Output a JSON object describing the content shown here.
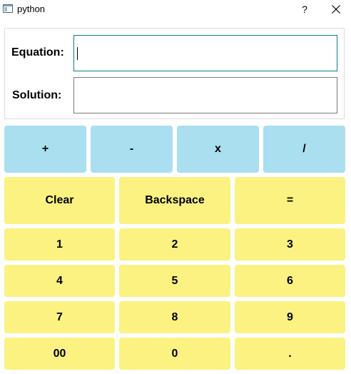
{
  "window": {
    "title": "python",
    "help_label": "?"
  },
  "form": {
    "equation_label": "Equation:",
    "equation_value": "",
    "solution_label": "Solution:",
    "solution_value": ""
  },
  "operators": [
    "+",
    "-",
    "x",
    "/"
  ],
  "controls": [
    "Clear",
    "Backspace",
    "="
  ],
  "keypad": [
    [
      "1",
      "2",
      "3"
    ],
    [
      "4",
      "5",
      "6"
    ],
    [
      "7",
      "8",
      "9"
    ],
    [
      "00",
      "0",
      "."
    ]
  ],
  "colors": {
    "operator_bg": "#a9dfef",
    "number_bg": "#fbf282",
    "focus_border": "#0f7c88"
  }
}
